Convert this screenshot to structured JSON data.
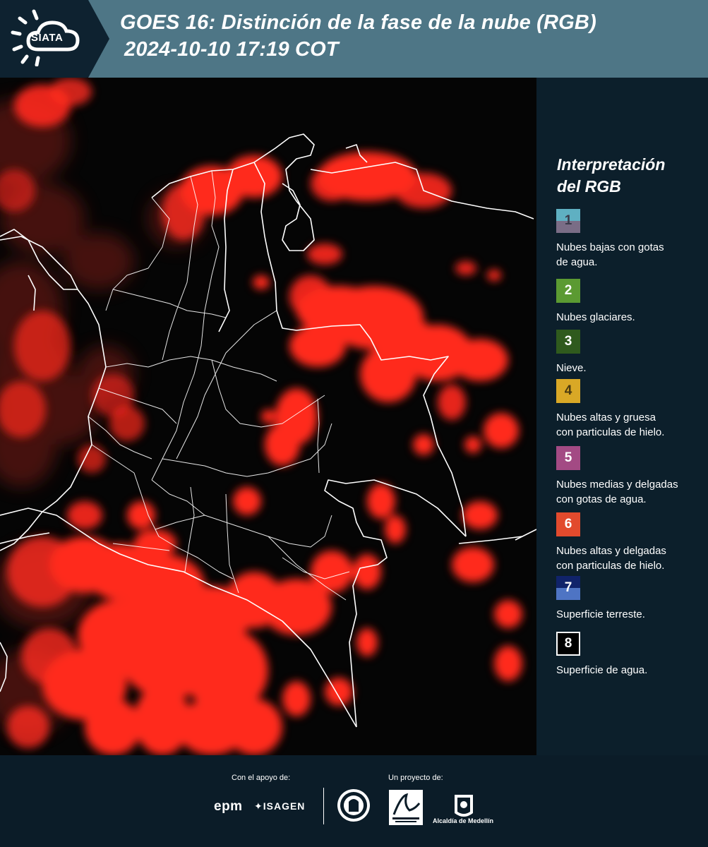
{
  "header": {
    "logo_text": "SIATA",
    "title_line1": "GOES 16: Distinción de la fase de la nube (RGB)",
    "title_line2": "2024-10-10 17:19 COT"
  },
  "legend": {
    "title_line1": "Interpretación",
    "title_line2": "del RGB",
    "items": [
      {
        "number": "1",
        "label_lines": [
          "Nubes bajas con gotas",
          "de agua."
        ],
        "color_top": "#5fb0c2",
        "color_bottom": "#7a6d86"
      },
      {
        "number": "2",
        "label_lines": [
          "Nubes glaciares."
        ],
        "color_top": "#5b9a32",
        "color_bottom": "#5b9a32"
      },
      {
        "number": "3",
        "label_lines": [
          "Nieve."
        ],
        "color_top": "#2f5a1d",
        "color_bottom": "#2f5a1d"
      },
      {
        "number": "4",
        "label_lines": [
          "Nubes altas y gruesa",
          "con particulas de hielo."
        ],
        "color_top": "#d9a826",
        "color_bottom": "#d9a826"
      },
      {
        "number": "5",
        "label_lines": [
          "Nubes medias y delgadas",
          "con gotas de agua."
        ],
        "color_top": "#a34a84",
        "color_bottom": "#a34a84"
      },
      {
        "number": "6",
        "label_lines": [
          "Nubes altas y delgadas",
          "con particulas de hielo."
        ],
        "color_top": "#e24a2d",
        "color_bottom": "#e24a2d"
      },
      {
        "number": "7",
        "label_lines": [
          "Superficie terreste."
        ],
        "color_top": "#10236a",
        "color_bottom": "#4e74c4"
      },
      {
        "number": "8",
        "label_lines": [
          "Superficie de agua."
        ],
        "color_top": "#000000",
        "color_bottom": "#000000"
      }
    ]
  },
  "footer": {
    "support_label": "Con el apoyo de:",
    "project_label": "Un proyecto de:",
    "sponsor_1": "epm",
    "sponsor_2": "ISAGEN",
    "partner_3": "Alcaldía de Medellín"
  },
  "map": {
    "cloud_color": "#ff2a1e",
    "border_color": "#ffffff",
    "background_color": "#050505"
  }
}
